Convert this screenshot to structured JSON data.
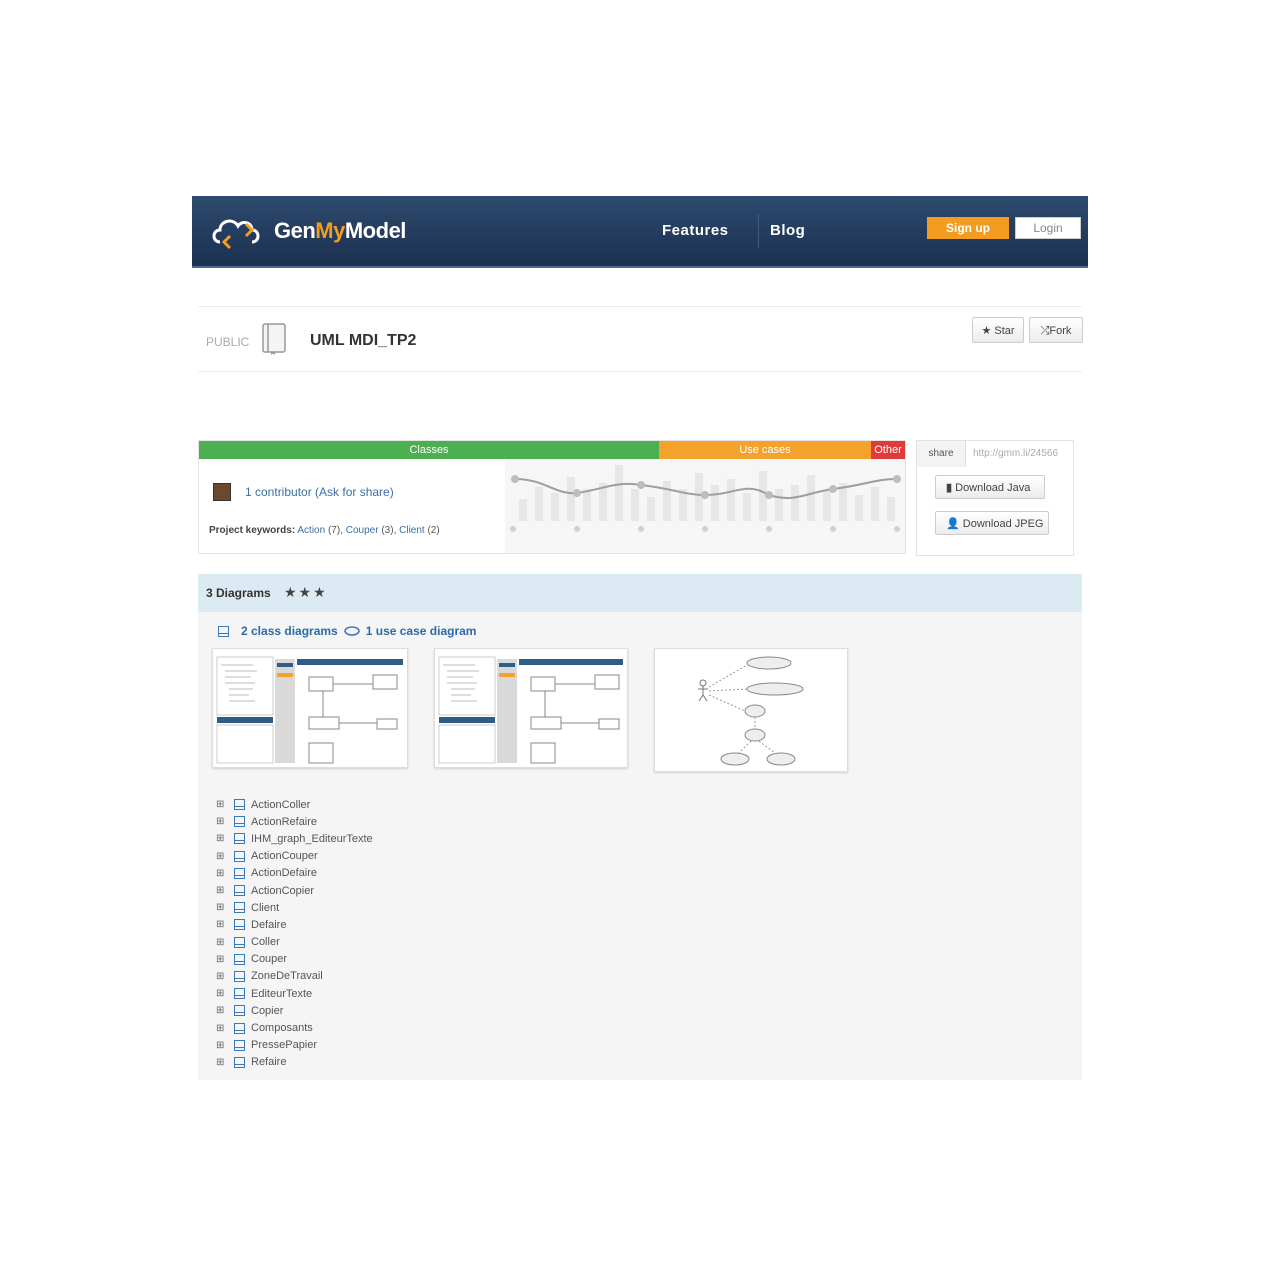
{
  "header": {
    "logo_prefix": "Gen",
    "logo_accent": "My",
    "logo_suffix": "Model",
    "nav": [
      "Features",
      "Blog"
    ],
    "signup_label": "Sign up",
    "login_label": "Login"
  },
  "project": {
    "visibility": "PUBLIC",
    "name": "UML MDI_TP2",
    "star_label": "★ Star",
    "fork_label": "⤮Fork"
  },
  "categories": [
    {
      "label": "Classes",
      "color": "#4caf50"
    },
    {
      "label": "Use cases",
      "color": "#f5a22d"
    },
    {
      "label": "Other",
      "color": "#e03a3a"
    }
  ],
  "info": {
    "contributors": "1 contributor (Ask for share)",
    "keywords_label": "Project keywords:",
    "keywords": [
      "Action",
      "Couper",
      "Client"
    ],
    "keyword_counts": [
      " (7), ",
      " (3), ",
      " (2)"
    ]
  },
  "share": {
    "label": "share",
    "url": "http://gmm.li/24566",
    "download_java": "Download Java",
    "download_jpeg": "Download JPEG"
  },
  "diagrams": {
    "title": "3 Diagrams",
    "stars": "★★★",
    "class_link": "2 class diagrams",
    "usecase_link": "1 use case diagram"
  },
  "tree_items": [
    "ActionColler",
    "ActionRefaire",
    "IHM_graph_EditeurTexte",
    "ActionCouper",
    "ActionDefaire",
    "ActionCopier",
    "Client",
    "Defaire",
    "Coller",
    "Couper",
    "ZoneDeTravail",
    "EditeurTexte",
    "Copier",
    "Composants",
    "PressePapier",
    "Refaire"
  ]
}
